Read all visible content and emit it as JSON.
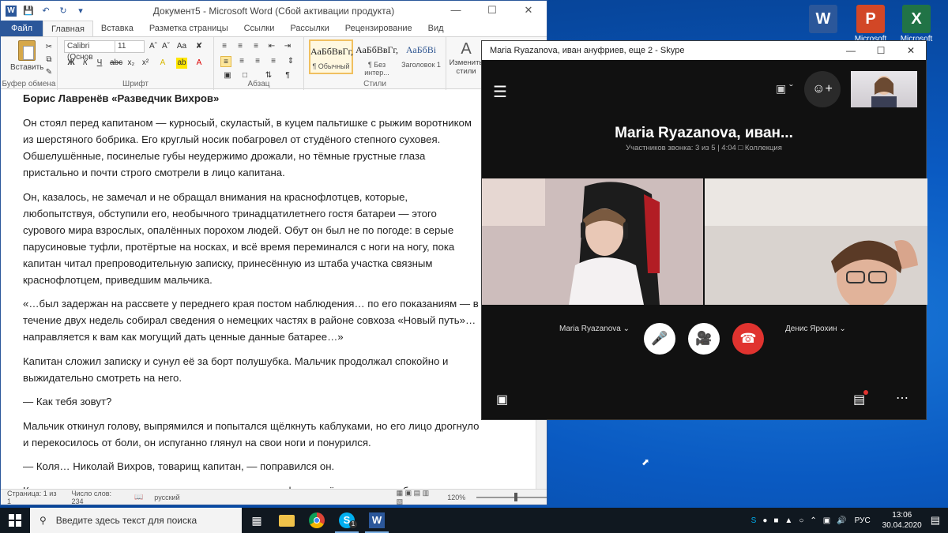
{
  "desktop": {
    "icons": [
      {
        "label": "",
        "letter": "W",
        "color": "#2b579a"
      },
      {
        "label": "Microsoft",
        "letter": "P",
        "color": "#d24726"
      },
      {
        "label": "Microsoft",
        "letter": "X",
        "color": "#217346"
      }
    ]
  },
  "word": {
    "title": "Документ5  -  Microsoft Word (Сбой активации продукта)",
    "tabs": [
      "Файл",
      "Главная",
      "Вставка",
      "Разметка страницы",
      "Ссылки",
      "Рассылки",
      "Рецензирование",
      "Вид"
    ],
    "active_tab": "Главная",
    "ribbon": {
      "paste_label": "Вставить",
      "clipboard_label": "Буфер обмена",
      "font_name": "Calibri (Основ",
      "font_size": "11",
      "font_label": "Шрифт",
      "paragraph_label": "Абзац",
      "styles_label": "Стили",
      "styles": [
        {
          "preview": "АаБбВвГг,",
          "name": "¶ Обычный"
        },
        {
          "preview": "АаБбВвГг,",
          "name": "¶ Без интер..."
        },
        {
          "preview": "АаБбВі",
          "name": "Заголовок 1"
        }
      ],
      "change_styles_label": "Изменить стили"
    },
    "document": {
      "heading": "Борис Лавренёв «Разведчик Вихров»",
      "paragraphs": [
        "Он стоял перед капитаном — курносый, скуластый, в куцем пальтишке с рыжим воротником из шерстяного бобрика. Его круглый носик побагровел от студёного степного суховея. Обшелушённые, посинелые губы неудержимо дрожали, но тёмные грустные глаза пристально и почти строго смотрели в лицо капитана.",
        "Он, казалось, не замечал и не обращал внимания на краснофлотцев, которые, любопытствуя, обступили его, необычного тринадцатилетнего гостя батареи — этого сурового мира взрослых, опалённых порохом людей. Обут он был не по погоде: в серые парусиновые туфли, протёртые на носках, и всё время переминался с ноги на ногу, пока капитан читал препроводительную записку, принесённую из штаба участка связным краснофлотцем, приведшим мальчика.",
        "«…был задержан на рассвете у переднего края постом наблюдения… по его показаниям — в течение двух недель собирал сведения о немецких частях в районе совхоза «Новый путь»… направляется к вам как могущий дать ценные данные батарее…»",
        "Капитан сложил записку и сунул её за борт полушубка. Мальчик продолжал спокойно и выжидательно смотреть на него.",
        "— Как тебя зовут?",
        "Мальчик откинул голову, выпрямился и попытался щёлкнуть каблуками, но его лицо дрогнуло и перекосилось от боли, он испуганно глянул на свои ноги и понурился.",
        "— Коля… Николай Вихров, товарищ капитан, — поправился он.",
        "Капитан тоже посмотрел на его ноги, на порванные туфли и поёжился от озноба."
      ]
    },
    "status": {
      "page": "Страница: 1 из 1",
      "words": "Число слов: 234",
      "language": "русский",
      "zoom": "120%"
    }
  },
  "skype": {
    "title": "Maria Ryazanova, иван ануфриев, еще 2 - Skype",
    "call_name": "Maria Ryazanova, иван...",
    "call_info": "Участников звонка: 3 из 5 | 4:04",
    "collection_label": "Коллекция",
    "participants": [
      "Maria Ryazanova",
      "Денис Ярохин"
    ],
    "end_call_color": "#e0332f"
  },
  "taskbar": {
    "search_placeholder": "Введите здесь текст для поиска",
    "tray_lang": "РУС",
    "time": "13:06",
    "date": "30.04.2020",
    "skype_badge": "1"
  }
}
